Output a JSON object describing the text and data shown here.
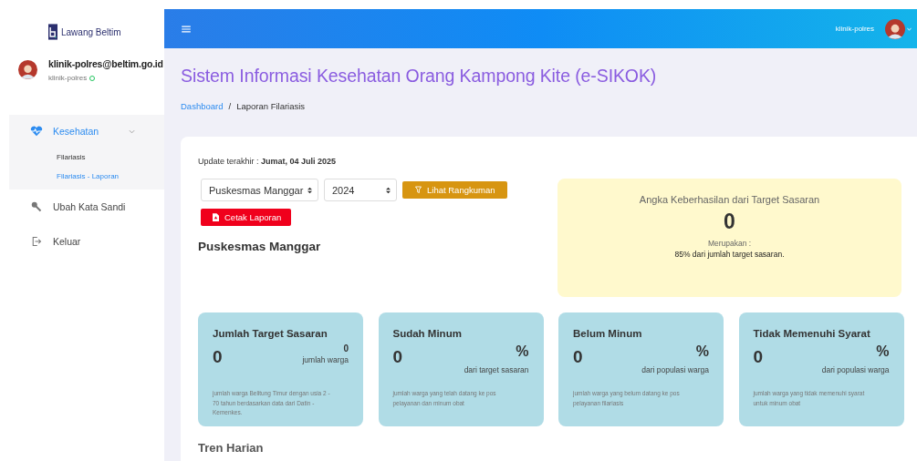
{
  "sidebar": {
    "logo": "Lawang Beltim",
    "user": {
      "email": "klinik-polres@beltim.go.id",
      "name": "klinik-polres",
      "online": true
    },
    "items": [
      {
        "label": "Kesehatan",
        "expanded": true,
        "selected": true,
        "children": [
          {
            "label": "Filariasis",
            "selected": false
          },
          {
            "label": "Filariasis - Laporan",
            "selected": true
          }
        ]
      },
      {
        "label": "Ubah Kata Sandi",
        "selected": false
      },
      {
        "label": "Keluar",
        "selected": false
      }
    ]
  },
  "topbar": {
    "username": "klinik-polres"
  },
  "page": {
    "title": "Sistem Informasi Kesehatan Orang Kampong Kite (e-SIKOK)",
    "breadcrumb_separator": "/",
    "breadcrumb": [
      {
        "label": "Dashboard",
        "link": true
      },
      {
        "label": "Laporan Filariasis",
        "link": false
      }
    ]
  },
  "report": {
    "update_label": "Update terakhir :",
    "update_value": "Jumat, 04 Juli 2025",
    "filters": [
      {
        "value": "Puskesmas Manggar"
      },
      {
        "value": "2024"
      }
    ],
    "summary_button": "Lihat Rangkuman",
    "print_button": "Cetak Laporan",
    "heading": "Puskesmas Manggar",
    "highlight": {
      "title": "Angka Keberhasilan dari Target Sasaran",
      "value": "0",
      "caption": "Merupakan :",
      "detail": "85% dari jumlah target sasaran."
    },
    "stats": [
      {
        "title": "Jumlah Target Sasaran",
        "value": "0",
        "unit": "0",
        "unit_label": "jumlah warga",
        "note": "jumlah warga Belitung Timur dengan usia 2 - 70 tahun berdasarkan data dari Datin - Kemenkes."
      },
      {
        "title": "Sudah Minum",
        "value": "0",
        "unit": "%",
        "unit_label": "dari target sasaran",
        "note": "jumlah warga yang telah datang ke pos pelayanan dan minum obat"
      },
      {
        "title": "Belum Minum",
        "value": "0",
        "unit": "%",
        "unit_label": "dari populasi warga",
        "note": "jumlah warga yang belum datang ke pos pelayanan filariasis"
      },
      {
        "title": "Tidak Memenuhi Syarat",
        "value": "0",
        "unit": "%",
        "unit_label": "dari populasi warga",
        "note": "jumlah warga yang tidak memenuhi syarat untuk minum obat"
      }
    ],
    "next_heading": "Tren Harian"
  }
}
